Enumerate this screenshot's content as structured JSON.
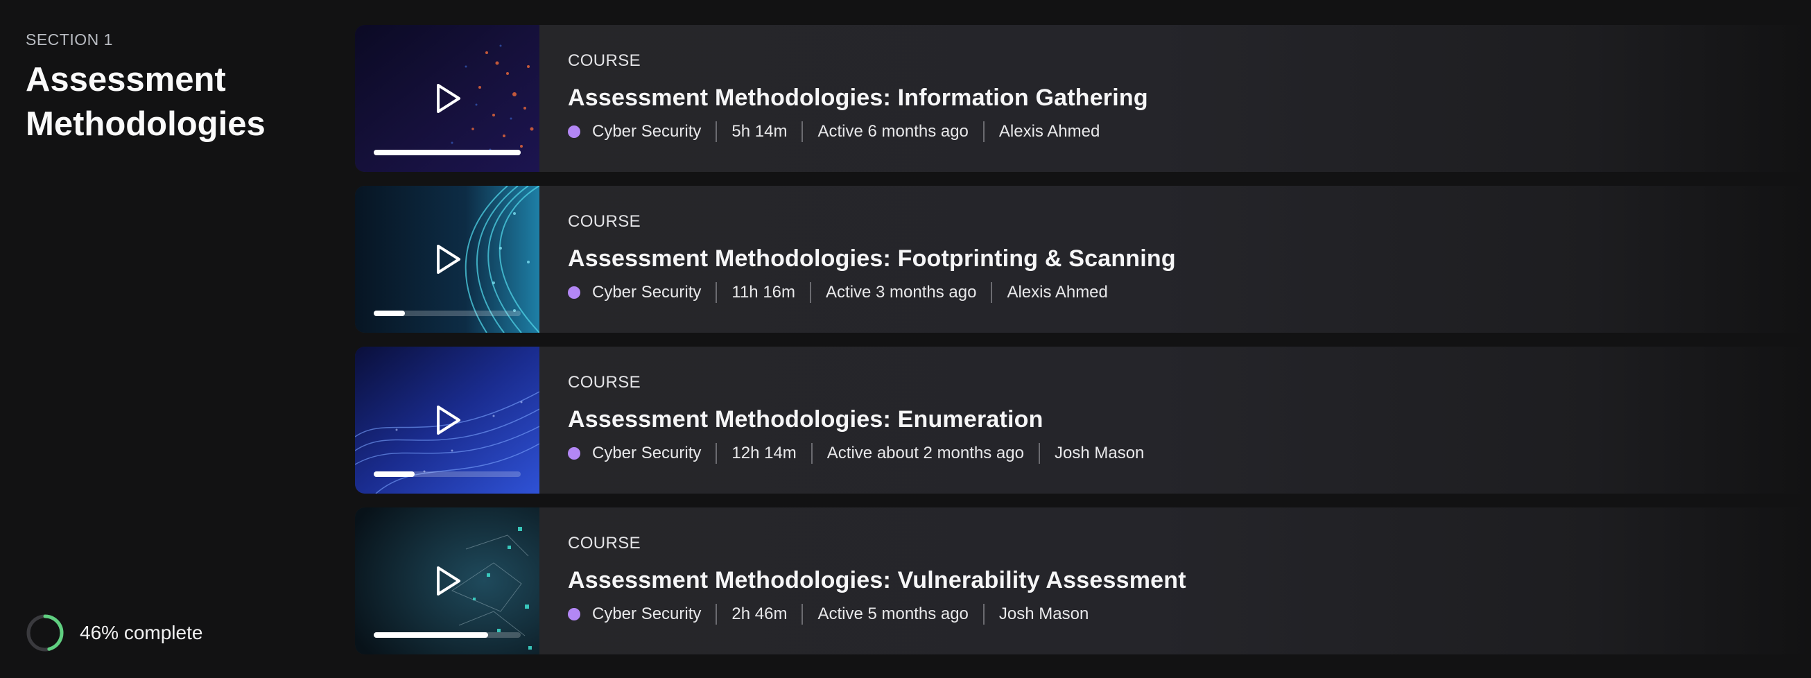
{
  "section": {
    "kicker": "SECTION 1",
    "title": "Assessment Methodologies",
    "progress_label": "46% complete",
    "progress_fraction": 0.46
  },
  "colors": {
    "topic_dot": "#b387f5",
    "progress_ring": "#5fcf80"
  },
  "courses": [
    {
      "kicker": "COURSE",
      "title": "Assessment Methodologies: Information Gathering",
      "topic": "Cyber Security",
      "duration": "5h 14m",
      "activity": "Active 6 months ago",
      "instructor": "Alexis Ahmed",
      "progress_fraction": 1.0,
      "thumb_icon": "play-icon"
    },
    {
      "kicker": "COURSE",
      "title": "Assessment Methodologies: Footprinting & Scanning",
      "topic": "Cyber Security",
      "duration": "11h 16m",
      "activity": "Active 3 months ago",
      "instructor": "Alexis Ahmed",
      "progress_fraction": 0.21,
      "thumb_icon": "play-icon"
    },
    {
      "kicker": "COURSE",
      "title": "Assessment Methodologies: Enumeration",
      "topic": "Cyber Security",
      "duration": "12h 14m",
      "activity": "Active about 2 months ago",
      "instructor": "Josh Mason",
      "progress_fraction": 0.28,
      "thumb_icon": "play-icon"
    },
    {
      "kicker": "COURSE",
      "title": "Assessment Methodologies: Vulnerability Assessment",
      "topic": "Cyber Security",
      "duration": "2h 46m",
      "activity": "Active 5 months ago",
      "instructor": "Josh Mason",
      "progress_fraction": 0.78,
      "thumb_icon": "play-icon"
    }
  ]
}
